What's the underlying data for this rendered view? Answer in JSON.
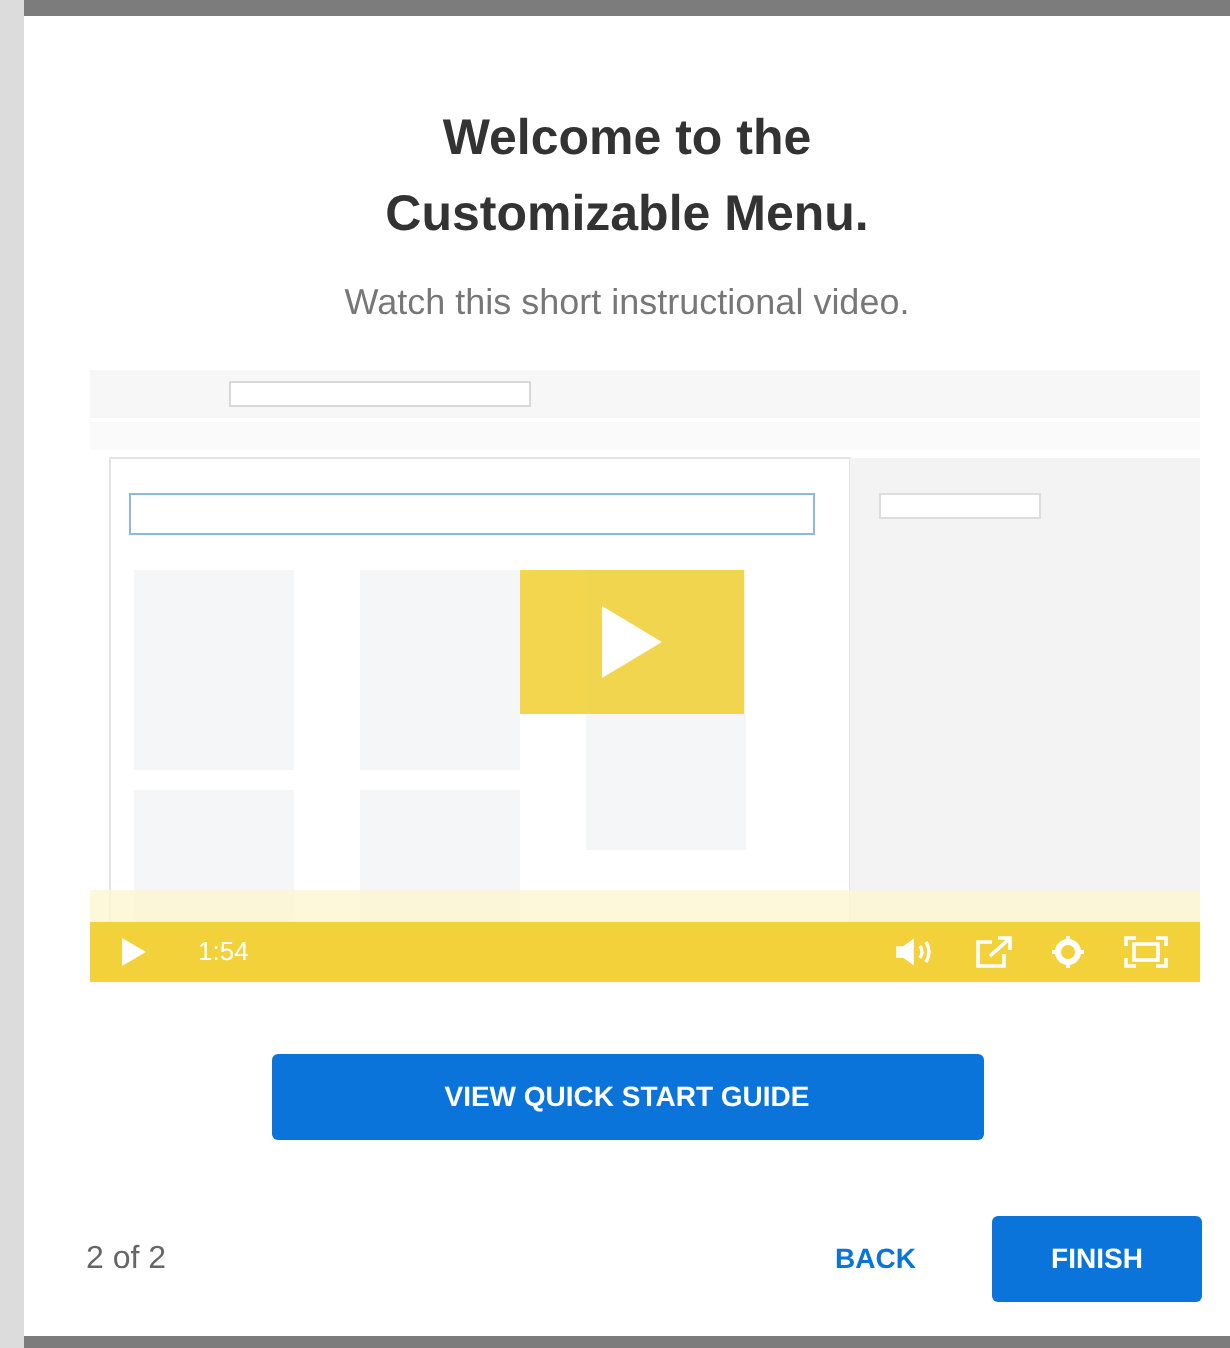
{
  "dialog": {
    "title": "Welcome to the Customizable Menu.",
    "subtitle": "Watch this short instructional video."
  },
  "video": {
    "playing": false,
    "time": "1:54"
  },
  "guide_button": "VIEW QUICK START GUIDE",
  "footer": {
    "step": "2 of 2",
    "back": "BACK",
    "finish": "FINISH"
  }
}
